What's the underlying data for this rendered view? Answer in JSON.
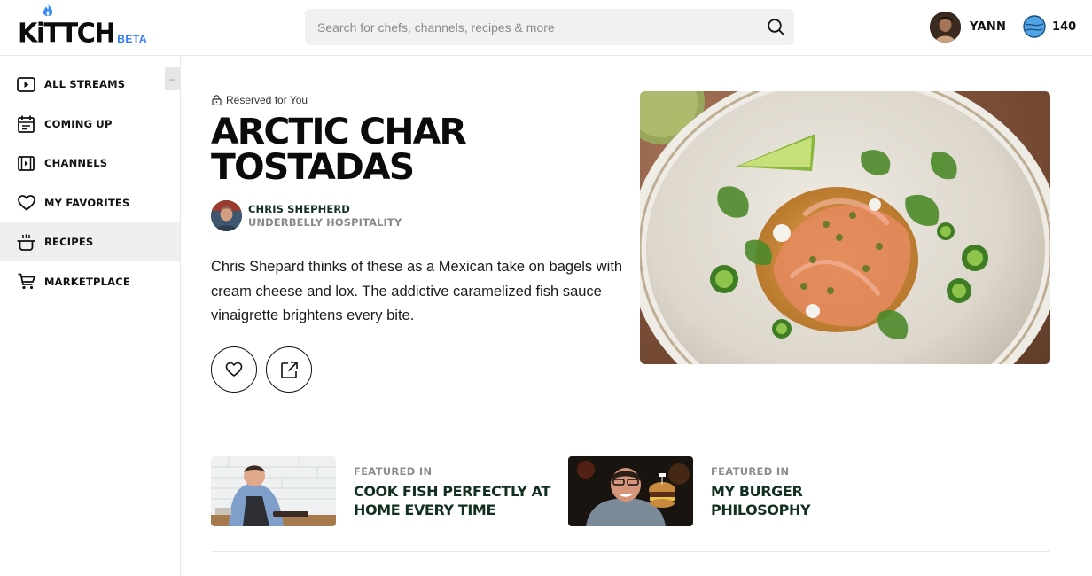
{
  "brand": {
    "logo": "KiTTCH",
    "badge": "BETA",
    "accent": "#2f7cf6"
  },
  "search": {
    "placeholder": "Search for chefs, channels, recipes & more",
    "value": ""
  },
  "user": {
    "name": "YANN",
    "coins": "140"
  },
  "sidebar": {
    "collapse_label": "–",
    "items": [
      {
        "label": "ALL STREAMS",
        "icon": "play-icon",
        "active": false
      },
      {
        "label": "COMING UP",
        "icon": "calendar-icon",
        "active": false
      },
      {
        "label": "CHANNELS",
        "icon": "film-icon",
        "active": false
      },
      {
        "label": "MY FAVORITES",
        "icon": "heart-icon",
        "active": false
      },
      {
        "label": "RECIPES",
        "icon": "pot-icon",
        "active": true
      },
      {
        "label": "MARKETPLACE",
        "icon": "cart-icon",
        "active": false
      }
    ]
  },
  "recipe": {
    "reserved_label": "Reserved for You",
    "title_line1": "ARCTIC CHAR",
    "title_line2": "TOSTADAS",
    "chef_name": "CHRIS SHEPHERD",
    "chef_org": "UNDERBELLY HOSPITALITY",
    "description": "Chris Shepard thinks of these as a Mexican take on bagels with cream cheese and lox. The addictive caramelized fish sauce vinaigrette brightens every bite."
  },
  "featured": [
    {
      "kicker": "FEATURED IN",
      "title": "COOK FISH PERFECTLY AT HOME EVERY TIME"
    },
    {
      "kicker": "FEATURED IN",
      "title": "MY BURGER PHILOSOPHY"
    }
  ],
  "colors": {
    "dark_green": "#12301f",
    "muted": "#8a8a8a",
    "active_bg": "#efefef"
  }
}
